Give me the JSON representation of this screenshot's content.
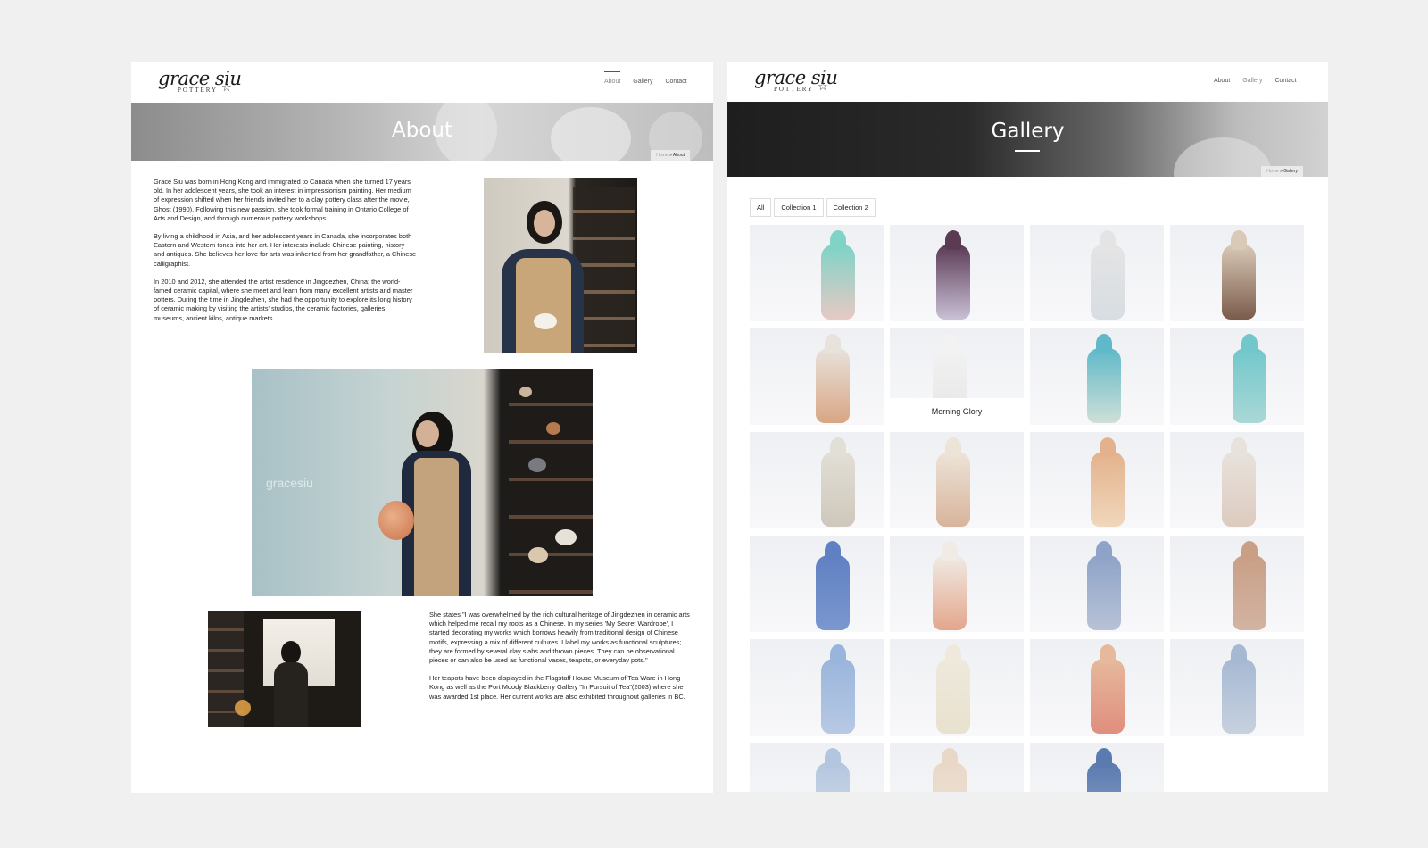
{
  "about_page": {
    "logo": {
      "script": "grace siu",
      "sub": "POTTERY"
    },
    "nav": [
      "About",
      "Gallery",
      "Contact"
    ],
    "active_nav": "About",
    "banner_title": "About",
    "breadcrumb": {
      "home": "Home",
      "sep": " » ",
      "current": "About"
    },
    "bio": [
      "Grace Siu was born in Hong Kong and immigrated to Canada when she turned 17 years old. In her adolescent years, she took an interest in impressionism painting. Her medium of expression shifted when her friends invited her to a clay pottery class after the movie, Ghost (1990). Following this new passion, she took formal training in Ontario College of Arts and Design, and through numerous pottery workshops.",
      "By living a childhood in Asia, and her adolescent years in Canada, she incorporates both Eastern and Western tones into her art. Her interests include Chinese painting, history and antiques. She believes her love for arts was inherited from her grandfather, a Chinese calligraphist.",
      "In 2010 and 2012, she attended the artist residence in Jingdezhen, China; the world-famed ceramic capital, where she meet and learn from many excellent artists and master potters. During the time in Jingdezhen, she had the opportunity to explore its long history of ceramic making by visiting the artists' studios, the ceramic factories, galleries, museums, ancient kilns, antique markets."
    ],
    "statement": [
      "She states \"I was overwhelmed by the rich cultural heritage of Jingdezhen in ceramic arts which helped me recall my roots as a Chinese. In my series 'My Secret Wardrobe', I started decorating my works which borrows heavily from traditional design of Chinese motifs, expressing a mix of different cultures. I label my works as functional sculptures; they are formed by several clay slabs and thrown pieces. They can be observational pieces or can also be used as functional vases, teapots, or everyday pots.\"",
      "Her teapots have been displayed in the Flagstaff House Museum of Tea Ware in Hong Kong as well as the Port Moody Blackberry Gallery \"In Pursuit of Tea\"(2003) where she was awarded 1st place. Her current works are also exhibited throughout galleries in BC."
    ],
    "watermark": "gracesiu"
  },
  "gallery_page": {
    "logo": {
      "script": "grace siu",
      "sub": "POTTERY"
    },
    "nav": [
      "About",
      "Gallery",
      "Contact"
    ],
    "active_nav": "Gallery",
    "banner_title": "Gallery",
    "breadcrumb": {
      "home": "Home",
      "sep": " » ",
      "current": "Gallery"
    },
    "filters": [
      "All",
      "Collection 1",
      "Collection 2"
    ],
    "hover_caption": "Morning Glory",
    "items": [
      {
        "glaze": "#7fd3c7",
        "base": "#e7c9c4"
      },
      {
        "glaze": "#5b3a54",
        "base": "#c9c1d6"
      },
      {
        "glaze": "#e4e4e4",
        "base": "#d7dde2"
      },
      {
        "glaze": "#d9c9b7",
        "base": "#7b5b4b"
      },
      {
        "glaze": "#e8e2dd",
        "base": "#d8a683"
      },
      {
        "glaze": "#f2f2f2",
        "base": "#e6e6e6"
      },
      {
        "glaze": "#5fb9c9",
        "base": "#cfdfd8"
      },
      {
        "glaze": "#72c7cb",
        "base": "#a9d8d6"
      },
      {
        "glaze": "#e2dfd6",
        "base": "#cfc7bb"
      },
      {
        "glaze": "#ede4d8",
        "base": "#d8b49c"
      },
      {
        "glaze": "#e3b28c",
        "base": "#f0d7bb"
      },
      {
        "glaze": "#e8e2dc",
        "base": "#dccbbf"
      },
      {
        "glaze": "#5f80c2",
        "base": "#7b97cf"
      },
      {
        "glaze": "#f0ebe5",
        "base": "#e3a68c"
      },
      {
        "glaze": "#8ea3c8",
        "base": "#b8c2d6"
      },
      {
        "glaze": "#c99f86",
        "base": "#d2b4a2"
      },
      {
        "glaze": "#9ab5dc",
        "base": "#b7c9e4"
      },
      {
        "glaze": "#efe9dc",
        "base": "#e8e1cf"
      },
      {
        "glaze": "#e6b99c",
        "base": "#e08e7d"
      },
      {
        "glaze": "#a6b9d3",
        "base": "#c7d1df"
      },
      {
        "glaze": "#b3c6e0",
        "base": "#d8dfe8"
      },
      {
        "glaze": "#e9d8c8",
        "base": "#ede2d6"
      },
      {
        "glaze": "#5b7bb0",
        "base": "#8aa1c7"
      }
    ]
  }
}
